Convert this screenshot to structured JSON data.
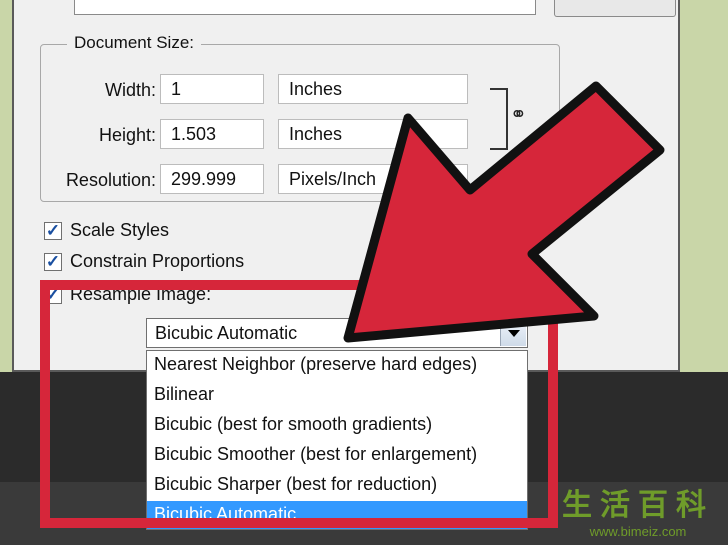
{
  "document_size": {
    "title": "Document Size:",
    "width": {
      "label": "Width:",
      "value": "1",
      "unit": "Inches"
    },
    "height": {
      "label": "Height:",
      "value": "1.503",
      "unit": "Inches"
    },
    "resolution": {
      "label": "Resolution:",
      "value": "299.999",
      "unit": "Pixels/Inch"
    }
  },
  "options": {
    "scale_styles": {
      "label": "Scale Styles",
      "checked": true
    },
    "constrain_proportions": {
      "label": "Constrain Proportions",
      "checked": true
    },
    "resample_image": {
      "label": "Resample Image:",
      "checked": true
    }
  },
  "resample": {
    "selected": "Bicubic Automatic",
    "options": [
      "Nearest Neighbor (preserve hard edges)",
      "Bilinear",
      "Bicubic (best for smooth gradients)",
      "Bicubic Smoother (best for enlargement)",
      "Bicubic Sharper (best for reduction)",
      "Bicubic Automatic"
    ]
  },
  "colors": {
    "highlight": "#d6263a",
    "selection": "#3399ff"
  },
  "watermark": {
    "chars": "生活百科",
    "url": "www.bimeiz.com"
  }
}
